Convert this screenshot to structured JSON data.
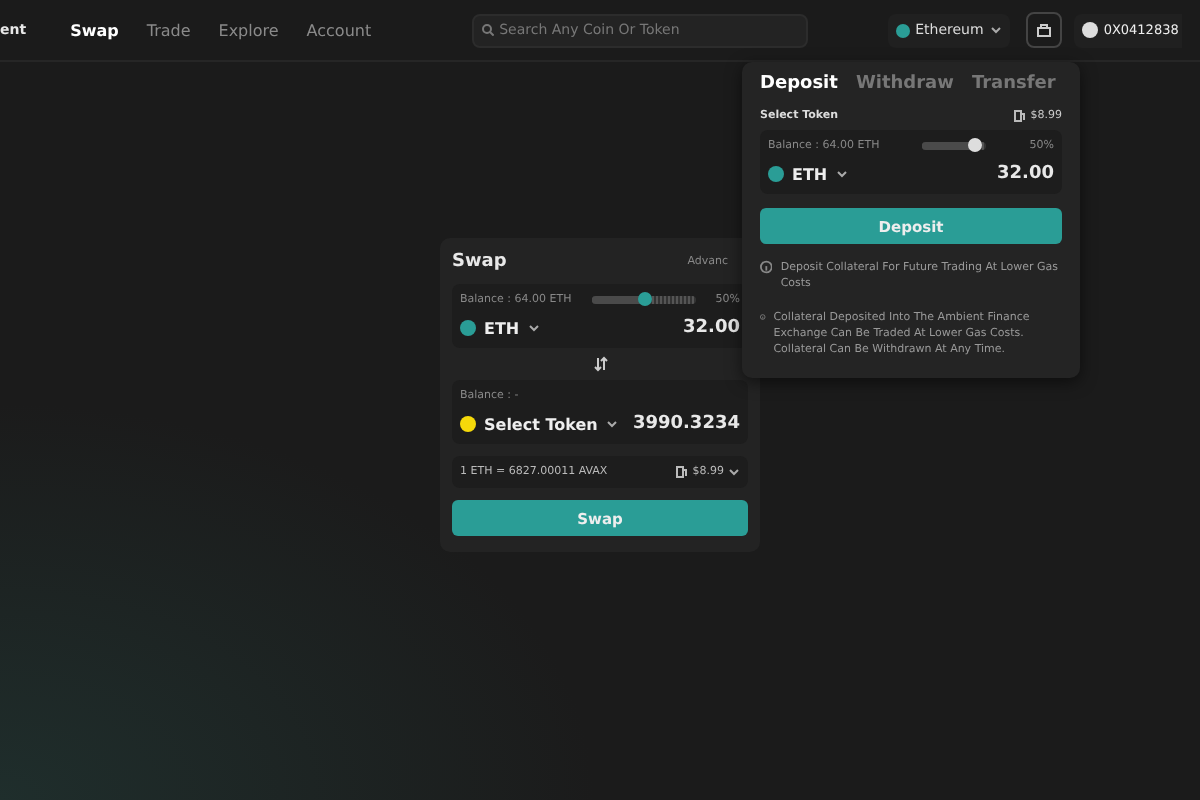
{
  "header": {
    "brand": "ent",
    "nav": [
      {
        "label": "Swap",
        "selected": true
      },
      {
        "label": "Trade",
        "selected": false
      },
      {
        "label": "Explore",
        "selected": false
      },
      {
        "label": "Account",
        "selected": false
      }
    ],
    "search": {
      "placeholder": "Search Any Coin Or Token"
    },
    "network": "Ethereum",
    "address": "0X0412838"
  },
  "swap": {
    "title": "Swap",
    "advanced": "Advanc",
    "from": {
      "balance": "Balance : 64.00 ETH",
      "level": 0.5,
      "percent": "50%",
      "token": "ETH",
      "amount": "32.00"
    },
    "to": {
      "balance": "Balance : -",
      "token": "Select Token",
      "amount": "3990.3234"
    },
    "rate": "1 ETH = 6827.00011 AVAX",
    "gas": "$8.99",
    "button": "Swap"
  },
  "deposit": {
    "tabs": [
      {
        "label": "Deposit",
        "selected": true
      },
      {
        "label": "Withdraw",
        "selected": false
      },
      {
        "label": "Transfer",
        "selected": false
      }
    ],
    "select_label": "Select Token",
    "gas": "$8.99",
    "balance": "Balance : 64.00 ETH",
    "level": 0.8,
    "percent": "50%",
    "token": "ETH",
    "amount": "32.00",
    "button": "Deposit",
    "notes": [
      "Deposit Collateral For Future Trading At Lower Gas Costs",
      "Collateral Deposited Into The Ambient Finance Exchange Can Be Traded At Lower Gas Costs. Collateral Can Be Withdrawn At Any Time."
    ]
  }
}
